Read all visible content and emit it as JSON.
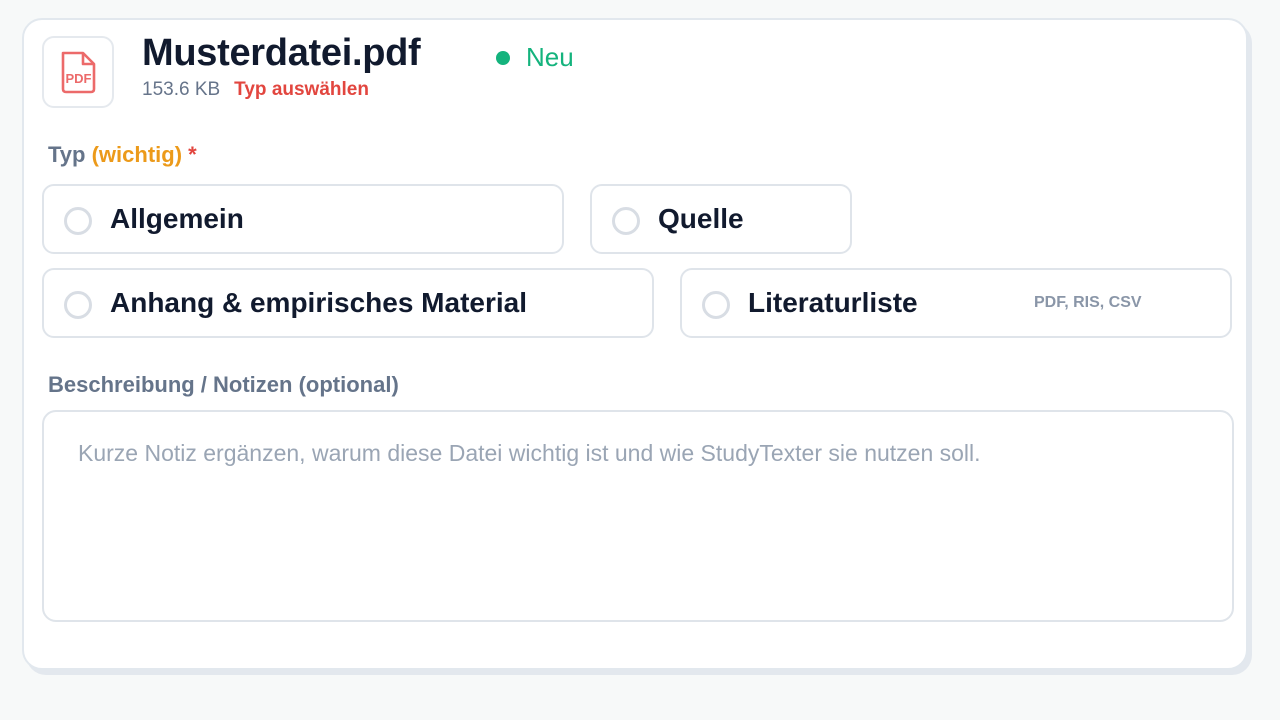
{
  "file": {
    "name": "Musterdatei.pdf",
    "size": "153.6 KB",
    "type_warning": "Typ auswählen",
    "icon": "pdf-file-icon",
    "icon_label": "PDF",
    "status": "Neu",
    "status_color": "#14b37d"
  },
  "type_section": {
    "label": "Typ",
    "hint": "(wichtig)",
    "required_marker": "*",
    "options": [
      {
        "label": "Allgemein",
        "note": "",
        "selected": false
      },
      {
        "label": "Quelle",
        "note": "",
        "selected": false
      },
      {
        "label": "Anhang & empirisches Material",
        "note": "",
        "selected": false
      },
      {
        "label": "Literaturliste",
        "note": "PDF, RIS, CSV",
        "selected": false
      }
    ]
  },
  "description": {
    "label": "Beschreibung / Notizen (optional)",
    "value": "",
    "placeholder": "Kurze Notiz ergänzen, warum diese Datei wichtig ist und wie StudyTexter sie nutzen soll."
  },
  "colors": {
    "accent_warning": "#e2463f",
    "hint": "#ec9a1a",
    "pdf_icon": "#ec6a6a"
  }
}
